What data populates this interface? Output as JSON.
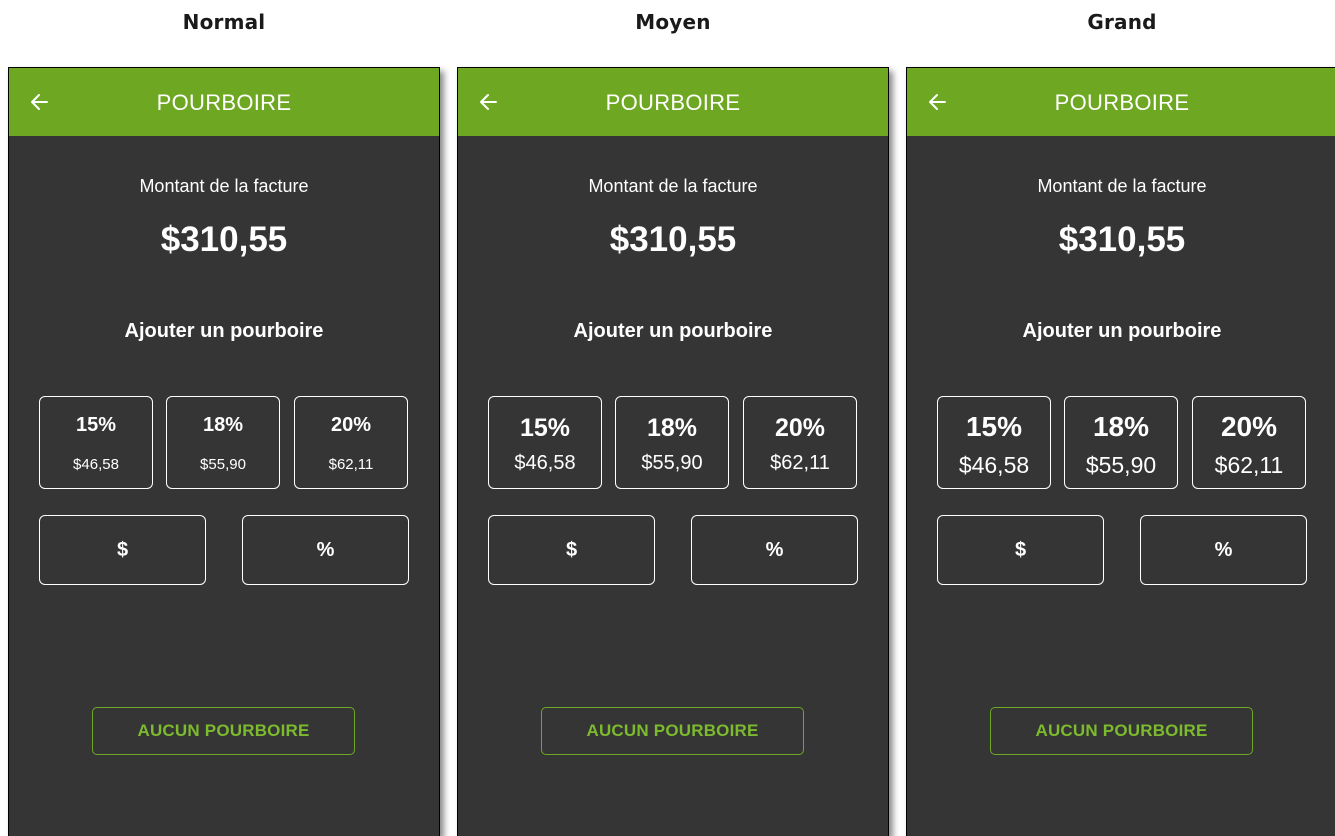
{
  "variants": [
    {
      "label": "Normal"
    },
    {
      "label": "Moyen"
    },
    {
      "label": "Grand"
    }
  ],
  "screen": {
    "title": "POURBOIRE",
    "back_icon": "arrow-left-icon",
    "bill_label": "Montant de la facture",
    "bill_amount": "$310,55",
    "add_tip_heading": "Ajouter un pourboire",
    "tips": [
      {
        "percent": "15%",
        "amount": "$46,58"
      },
      {
        "percent": "18%",
        "amount": "$55,90"
      },
      {
        "percent": "20%",
        "amount": "$62,11"
      }
    ],
    "custom_dollar": "$",
    "custom_percent": "%",
    "no_tip": "AUCUN POURBOIRE"
  },
  "colors": {
    "appbar": "#6ea823",
    "background": "#353535",
    "accent_text": "#7cba2e",
    "text": "#ffffff"
  }
}
